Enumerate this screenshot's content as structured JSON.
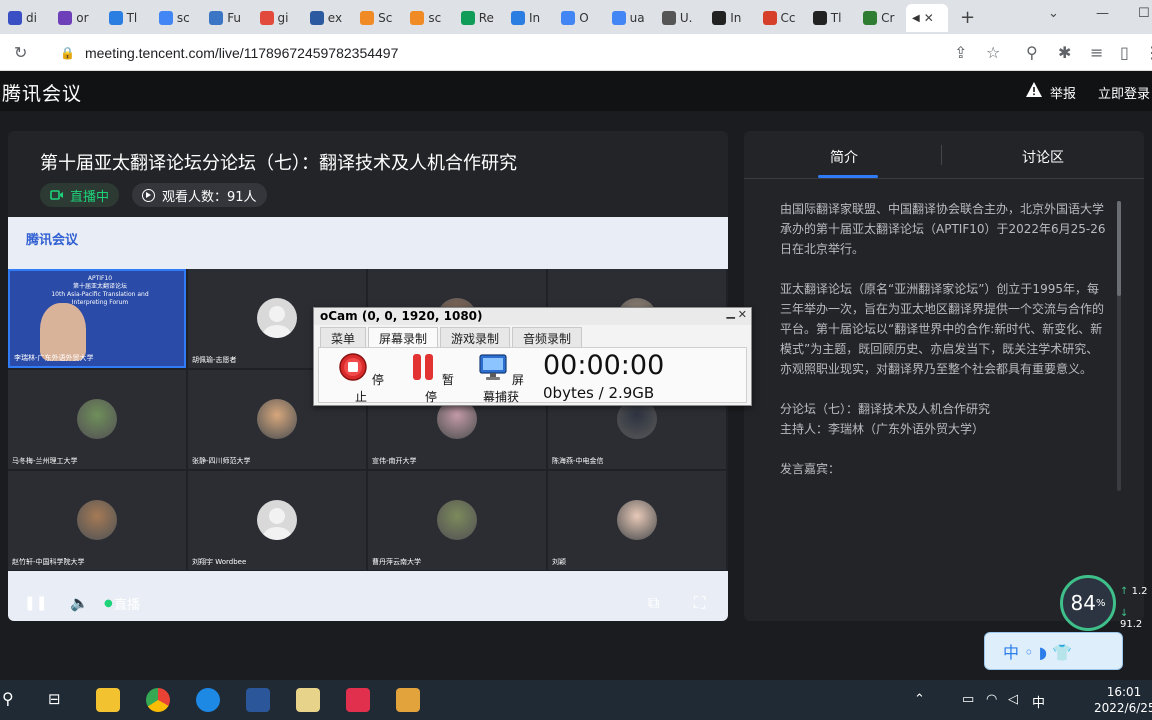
{
  "browser": {
    "tabs": [
      {
        "label": "di",
        "color": "#3b4fc4"
      },
      {
        "label": "or",
        "color": "#6d3fb8"
      },
      {
        "label": "Tl",
        "color": "#2a7de1"
      },
      {
        "label": "sc",
        "color": "#4285f4"
      },
      {
        "label": "Fu",
        "color": "#3b76c4"
      },
      {
        "label": "gi",
        "color": "#e24a3b"
      },
      {
        "label": "ex",
        "color": "#2c5aa0"
      },
      {
        "label": "Sc",
        "color": "#f08a24"
      },
      {
        "label": "sc",
        "color": "#f08a24"
      },
      {
        "label": "Re",
        "color": "#0f9d58"
      },
      {
        "label": "In",
        "color": "#2a7de1"
      },
      {
        "label": "O",
        "color": "#4285f4"
      },
      {
        "label": "ua",
        "color": "#4285f4"
      },
      {
        "label": "U.",
        "color": "#555555"
      },
      {
        "label": "In",
        "color": "#222222"
      },
      {
        "label": "Cc",
        "color": "#d6402b"
      },
      {
        "label": "Tl",
        "color": "#222222"
      },
      {
        "label": "Cr",
        "color": "#2e7d32"
      }
    ],
    "active_tab_close": "✕",
    "new_tab": "+",
    "url": "meeting.tencent.com/live/11789672459782354497"
  },
  "site": {
    "brand": "腾讯会议",
    "report": "举报",
    "login": "立即登录"
  },
  "live": {
    "title": "第十届亚太翻译论坛分论坛（七）：翻译技术及人机合作研究",
    "status": "直播中",
    "viewers": "观看人数：91人",
    "video_logo": "腾讯会议",
    "presenter_slide": "APTIF10\n第十届亚太翻译论坛\n10th Asia-Pacific Translation and Interpreting Forum",
    "participants": [
      {
        "name": "李瑞林-广东外语外贸大学",
        "avatar": "presenter"
      },
      {
        "name": "胡佩瑜-志愿者",
        "avatar": "person"
      },
      {
        "name": "",
        "avatar": "photo",
        "color": "#8a6a58"
      },
      {
        "name": "",
        "avatar": "photo",
        "color": "#9b8a7a"
      },
      {
        "name": "马冬梅-兰州理工大学",
        "avatar": "photo",
        "color": "#6f8f5a"
      },
      {
        "name": "张静-四川师范大学",
        "avatar": "photo",
        "color": "#d7a77c"
      },
      {
        "name": "宣伟-南开大学",
        "avatar": "photo",
        "color": "#c49aa8"
      },
      {
        "name": "陈海燕-中电金信",
        "avatar": "photo",
        "color": "#2d3340"
      },
      {
        "name": "赵竹轩-中国科学院大学",
        "avatar": "photo",
        "color": "#a57a55"
      },
      {
        "name": "刘翔宇 Wordbee",
        "avatar": "person"
      },
      {
        "name": "曹丹萍云南大学",
        "avatar": "photo",
        "color": "#7c8a5b"
      },
      {
        "name": "刘颖",
        "avatar": "photo",
        "color": "#e8c9b8"
      }
    ],
    "controls": {
      "pause": "❚❚",
      "volume": "🔈",
      "live_label": "直播",
      "pip": "⧉",
      "fullscreen": "⛶"
    }
  },
  "side": {
    "tabs": [
      "简介",
      "讨论区"
    ],
    "paragraphs": [
      "由国际翻译家联盟、中国翻译协会联合主办，北京外国语大学承办的第十届亚太翻译论坛（APTIF10）于2022年6月25-26日在北京举行。",
      "亚太翻译论坛（原名“亚洲翻译家论坛”）创立于1995年，每三年举办一次，旨在为亚太地区翻译界提供一个交流与合作的平台。第十届论坛以“翻译世界中的合作:新时代、新变化、新模式”为主题，既回顾历史、亦启发当下，既关注学术研究、亦观照职业现实，对翻译界乃至整个社会都具有重要意义。",
      "分论坛（七）：翻译技术及人机合作研究\n主持人：李瑞林（广东外语外贸大学）",
      "发言嘉宾："
    ]
  },
  "ocam": {
    "title": "oCam (0, 0, 1920, 1080)",
    "tabs": [
      "菜单",
      "屏幕录制",
      "游戏录制",
      "音频录制"
    ],
    "active_tab": 1,
    "buttons": [
      "停止",
      "暂停",
      "屏幕捕获"
    ],
    "timer": "00:00:00",
    "size": "0bytes / 2.9GB"
  },
  "widgets": {
    "meter_value": "84",
    "meter_unit": "%",
    "net_up": "1.2",
    "net_down": "91.2",
    "ime": "中 ◦ ◗ 👕"
  },
  "taskbar": {
    "tray_lang": "中",
    "time": "16:01",
    "date": "2022/6/25"
  }
}
